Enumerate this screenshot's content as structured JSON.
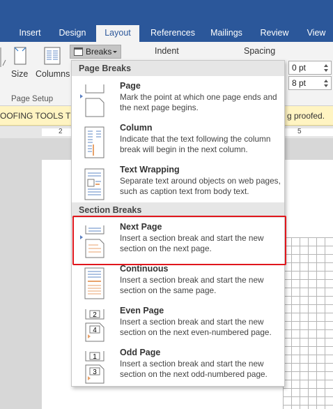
{
  "tabs": [
    {
      "label": "Insert"
    },
    {
      "label": "Design"
    },
    {
      "label": "Layout",
      "active": true
    },
    {
      "label": "References"
    },
    {
      "label": "Mailings"
    },
    {
      "label": "Review"
    },
    {
      "label": "View"
    }
  ],
  "ribbon": {
    "size_label": "Size",
    "columns_label": "Columns",
    "breaks_label": "Breaks",
    "indent_label": "Indent",
    "spacing_label": "Spacing",
    "spacing_before": "0 pt",
    "spacing_after": "8 pt",
    "page_setup_label": "Page Setup"
  },
  "proofing_bar": {
    "left_text": "OOFING TOOLS   TH",
    "right_text": "g proofed."
  },
  "ruler": {
    "num_2": "2",
    "num_5": "5"
  },
  "menu": {
    "page_breaks_header": "Page Breaks",
    "section_breaks_header": "Section Breaks",
    "items": [
      {
        "title": "Page",
        "desc": "Mark the point at which one page ends and the next page begins."
      },
      {
        "title": "Column",
        "desc": "Indicate that the text following the column break will begin in the next column."
      },
      {
        "title": "Text Wrapping",
        "desc": "Separate text around objects on web pages, such as caption text from body text."
      },
      {
        "title": "Next Page",
        "desc": "Insert a section break and start the new section on the next page."
      },
      {
        "title": "Continuous",
        "desc": "Insert a section break and start the new section on the same page."
      },
      {
        "title": "Even Page",
        "desc": "Insert a section break and start the new section on the next even-numbered page."
      },
      {
        "title": "Odd Page",
        "desc": "Insert a section break and start the new section on the next odd-numbered page."
      }
    ],
    "even_icon_digits": [
      "2",
      "4"
    ],
    "odd_icon_digits": [
      "1",
      "3"
    ]
  },
  "colors": {
    "ribbon_blue": "#2b579a",
    "highlight_red": "#e0161c",
    "accent_orange": "#e8a26b"
  }
}
